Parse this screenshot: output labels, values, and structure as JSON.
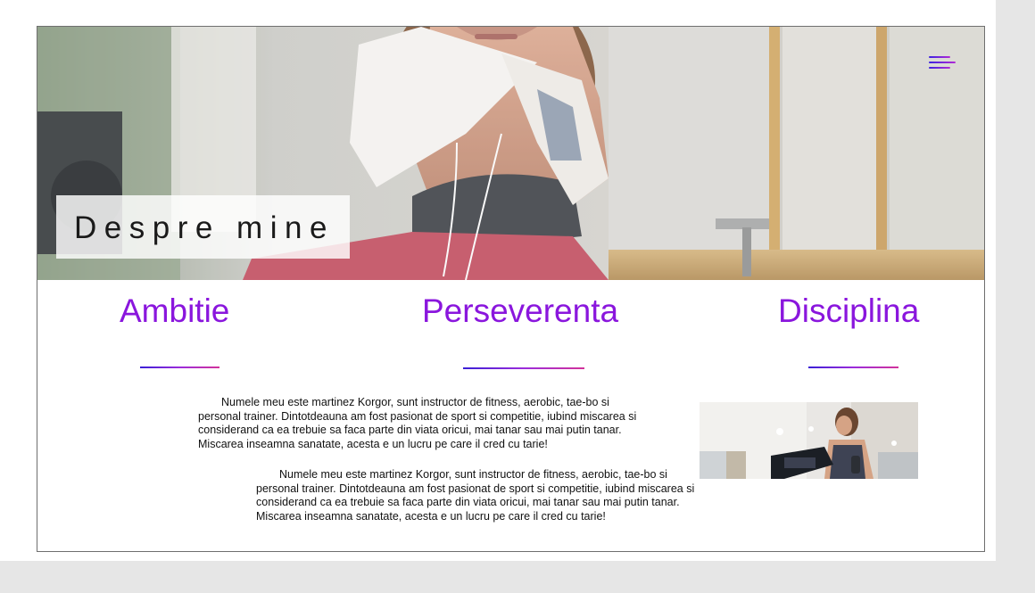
{
  "hero": {
    "title": "Despre mine",
    "menu_icon": "hamburger-menu-icon",
    "image": "woman-with-towel-at-gym-photo"
  },
  "values": {
    "items": [
      {
        "label": "Ambitie"
      },
      {
        "label": "Perseverenta"
      },
      {
        "label": "Disciplina"
      }
    ],
    "accent_color": "#8a16dd",
    "underline_colors": [
      "#3a1fd6",
      "#9b2cdb",
      "#d2339a"
    ]
  },
  "about": {
    "paragraph_1": "Numele meu este martinez Korgor, sunt instructor de fitness, aerobic, tae-bo si personal trainer. Dintotdeauna am fost pasionat de sport si competitie, iubind miscarea si considerand ca ea trebuie sa faca parte din viata oricui, mai tanar sau mai putin tanar. Miscarea inseamna sanatate, acesta e un lucru pe care il cred cu tarie!",
    "paragraph_2": "Numele meu este martinez Korgor, sunt instructor de fitness, aerobic, tae-bo si personal trainer. Dintotdeauna am fost pasionat de sport si competitie, iubind miscarea si considerand ca ea trebuie sa faca parte din viata oricui, mai tanar sau mai putin tanar. Miscarea inseamna sanatate, acesta e un lucru pe care il cred cu tarie!",
    "image": "woman-running-on-treadmill-photo"
  }
}
